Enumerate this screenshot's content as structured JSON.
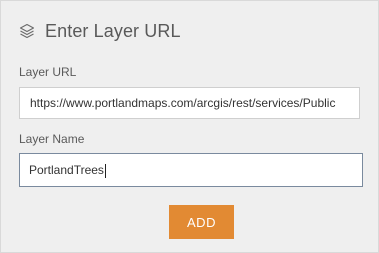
{
  "panel": {
    "title": "Enter Layer URL",
    "title_icon": "layers-icon"
  },
  "layer_url": {
    "label": "Layer URL",
    "value": "https://www.portlandmaps.com/arcgis/rest/services/Public"
  },
  "layer_name": {
    "label": "Layer Name",
    "value": "PortlandTrees"
  },
  "actions": {
    "add_label": "ADD"
  },
  "colors": {
    "accent": "#e28a33",
    "panel_background": "#efefef"
  }
}
